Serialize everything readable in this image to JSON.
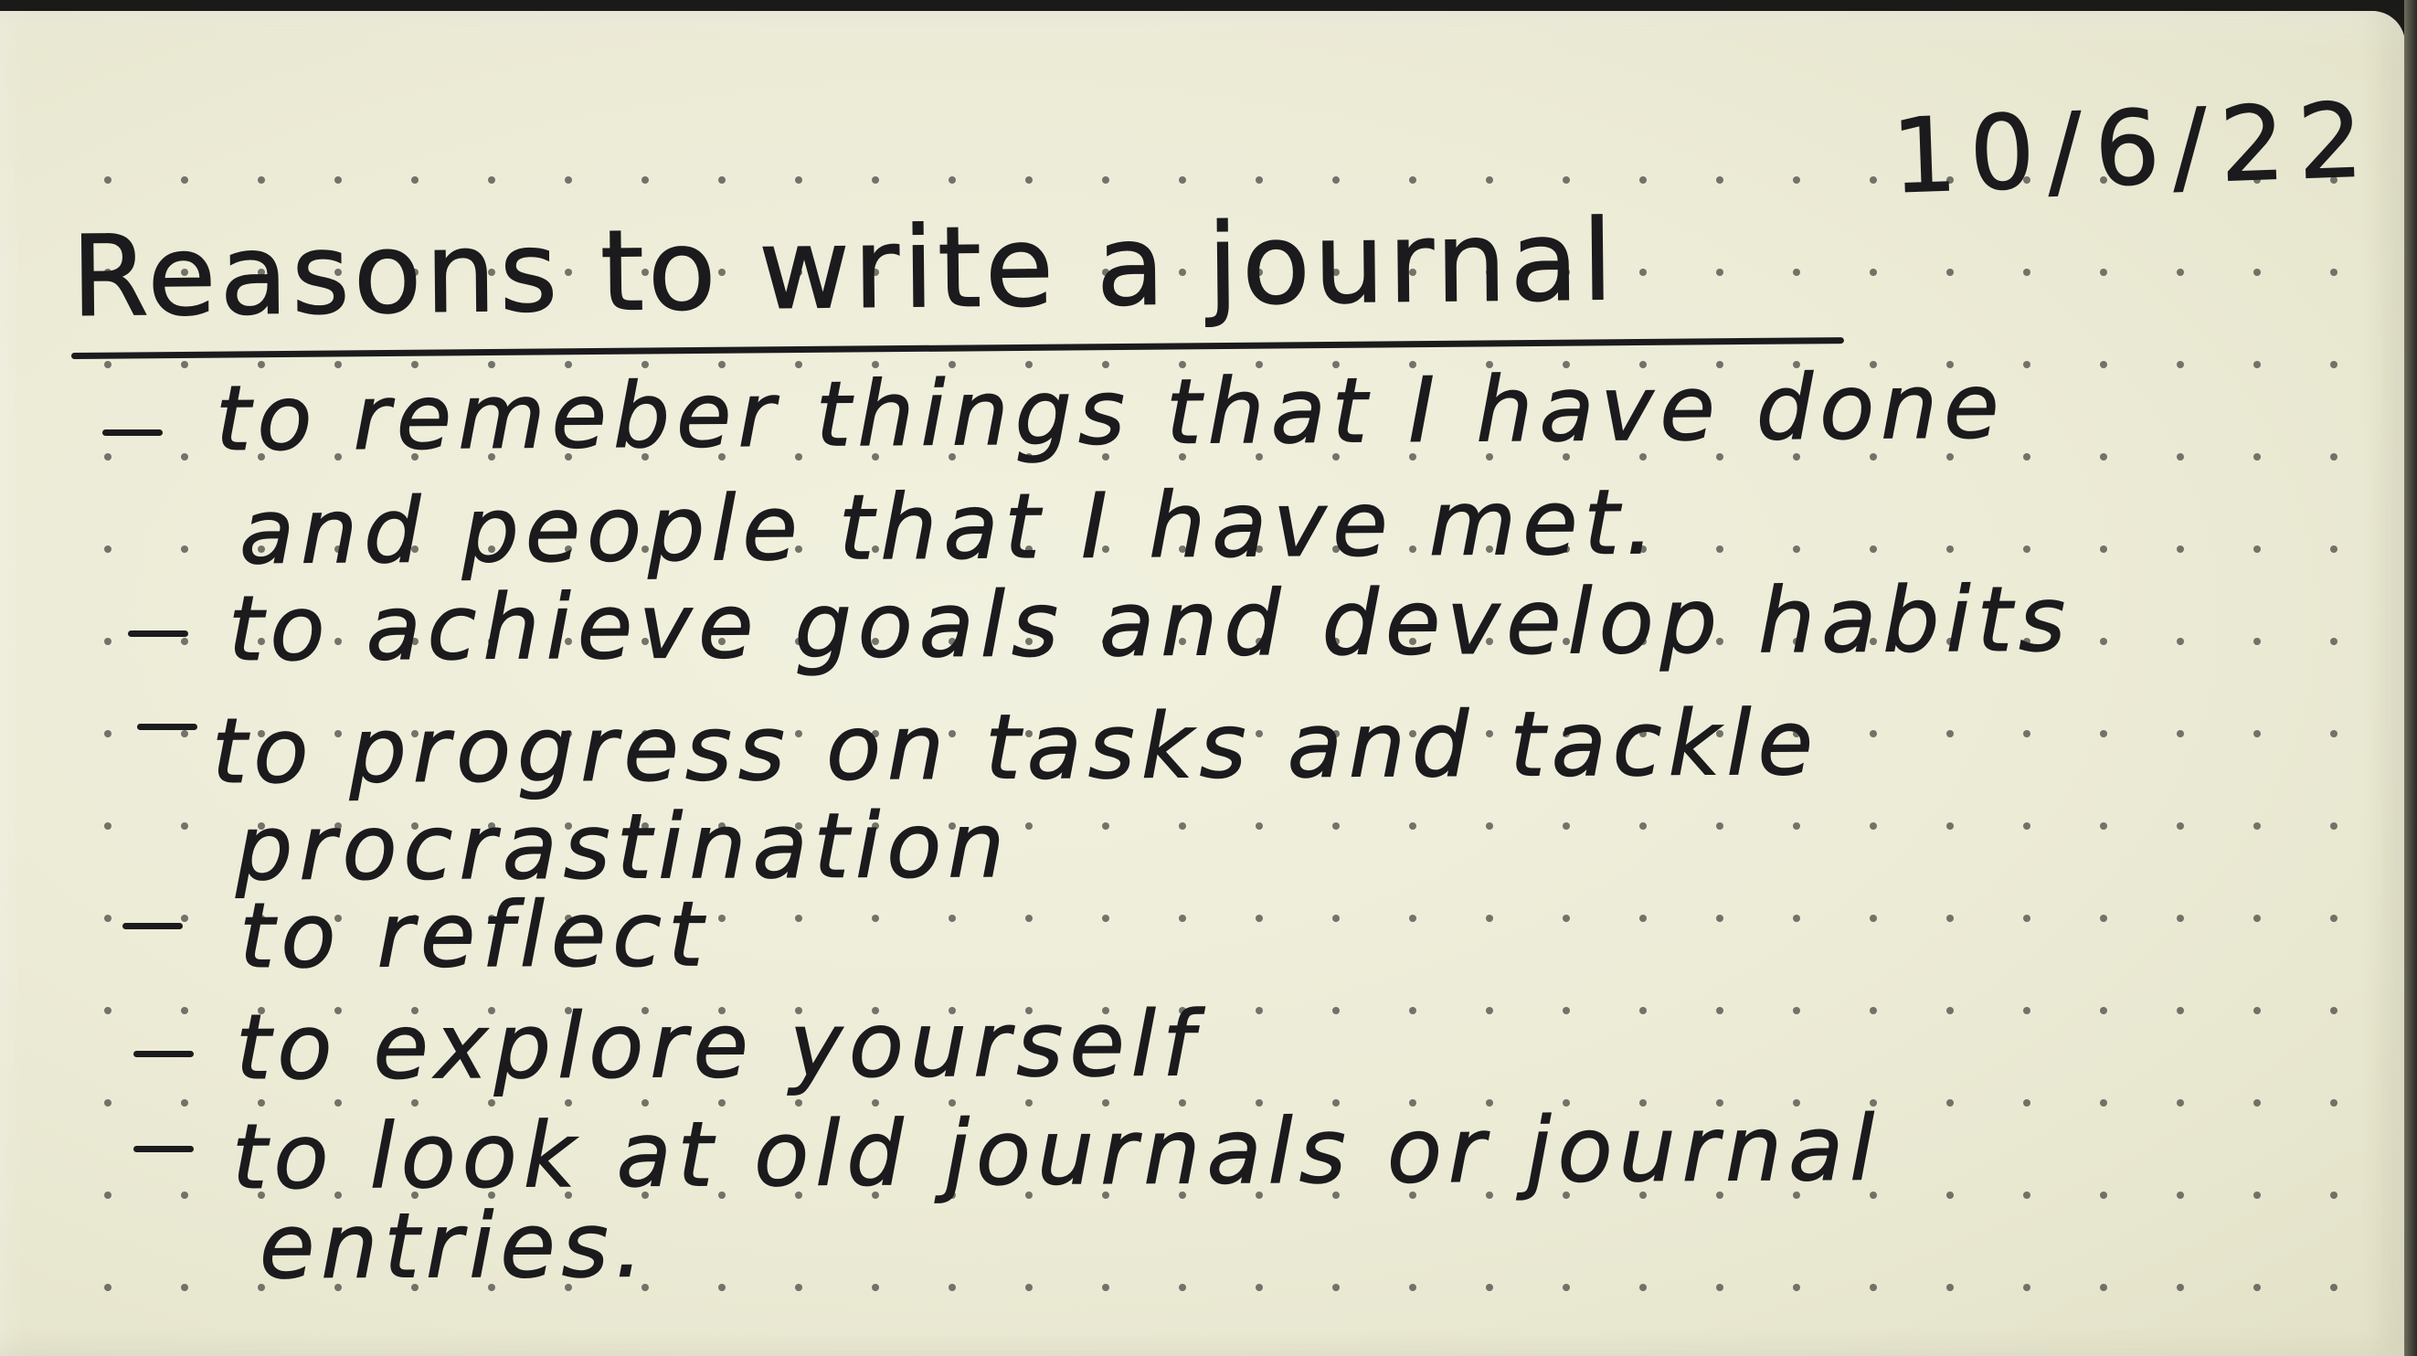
{
  "journal_page": {
    "date": "10/6/22",
    "title": "Reasons to write a journal",
    "items": [
      {
        "bullet": "-",
        "lines": [
          "to remeber things that I have done",
          "and people that I have met."
        ]
      },
      {
        "bullet": "-",
        "lines": [
          "to achieve goals and develop habits"
        ]
      },
      {
        "bullet": "-",
        "lines": [
          "to progress on tasks and tackle",
          "procrastination"
        ]
      },
      {
        "bullet": "-",
        "lines": [
          "to reflect"
        ]
      },
      {
        "bullet": "-",
        "lines": [
          "to explore yourself"
        ]
      },
      {
        "bullet": "-",
        "lines": [
          "to look at old journals or journal",
          "entries."
        ]
      }
    ]
  },
  "colors": {
    "paper": "#ecebd6",
    "ink": "#1b1b1e",
    "dots": "#4a4a44"
  }
}
